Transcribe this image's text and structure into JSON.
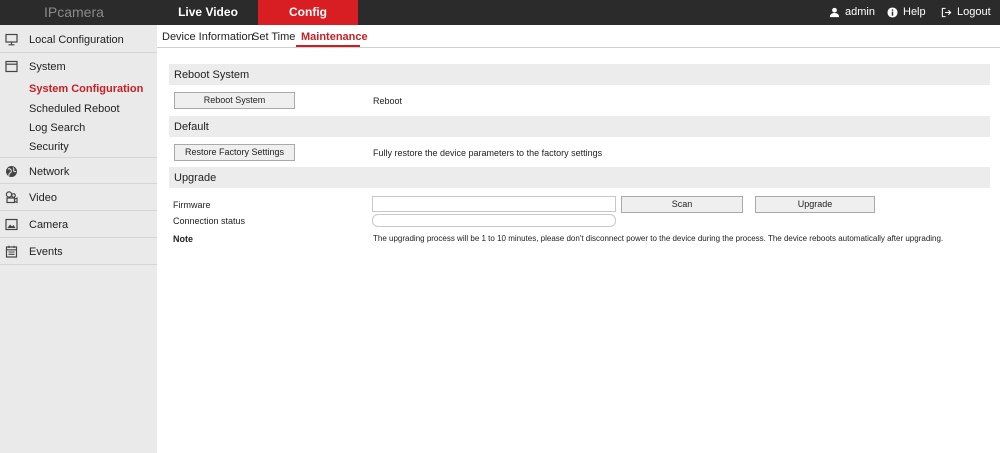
{
  "app": {
    "logo": "IPcamera"
  },
  "topnav": {
    "live_video": "Live Video",
    "config": "Config"
  },
  "user_menu": {
    "admin": "admin",
    "help": "Help",
    "logout": "Logout"
  },
  "sidebar": {
    "local_configuration": "Local Configuration",
    "system": "System",
    "system_items": [
      "System Configuration",
      "Scheduled Reboot",
      "Log Search",
      "Security"
    ],
    "network": "Network",
    "video": "Video",
    "camera": "Camera",
    "events": "Events"
  },
  "tabs": [
    "Device Information",
    "Set Time",
    "Maintenance"
  ],
  "reboot": {
    "title": "Reboot System",
    "button": "Reboot System",
    "description": "Reboot"
  },
  "default": {
    "title": "Default",
    "button": "Restore Factory Settings",
    "description": "Fully restore the device parameters to the factory settings"
  },
  "upgrade": {
    "title": "Upgrade",
    "firmware_label": "Firmware",
    "firmware_value": "",
    "scan_button": "Scan",
    "upgrade_button": "Upgrade",
    "connection_label": "Connection status",
    "connection_value": "",
    "note_label": "Note",
    "note_text": "The upgrading process will be 1 to 10 minutes, please don't disconnect power to the device during the process. The device reboots automatically after upgrading."
  },
  "colors": {
    "accent": "#d81e22",
    "topbar": "#2b2b2b",
    "sidebar": "#eaeaea"
  }
}
